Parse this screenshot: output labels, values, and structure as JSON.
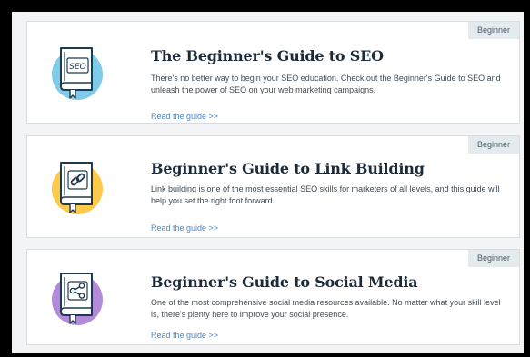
{
  "guides": [
    {
      "badge": "Beginner",
      "title": "The Beginner's Guide to SEO",
      "description": "There's no better way to begin your SEO education. Check out the Beginner's Guide to SEO and unleash the power of SEO on your web marketing campaigns.",
      "link": "Read the guide >>",
      "icon": "seo-book-icon",
      "icon_text": "SEO",
      "circle_color": "#7fcbe8"
    },
    {
      "badge": "Beginner",
      "title": "Beginner's Guide to Link Building",
      "description": "Link building is one of the most essential SEO skills for marketers of all levels, and this guide will help you set the right foot forward.",
      "link": "Read the guide >>",
      "icon": "link-book-icon",
      "circle_color": "#ffc94a"
    },
    {
      "badge": "Beginner",
      "title": "Beginner's Guide to Social Media",
      "description": "One of the most comprehensive social media resources available. No matter what your skill level is, there's plenty here to improve your social presence.",
      "link": "Read the guide >>",
      "icon": "share-book-icon",
      "circle_color": "#b28ad9"
    }
  ],
  "colors": {
    "link": "#4b87c7",
    "title": "#1c2b3a",
    "badge_bg": "#e3ebef",
    "book_stroke": "#1f3a4d"
  }
}
